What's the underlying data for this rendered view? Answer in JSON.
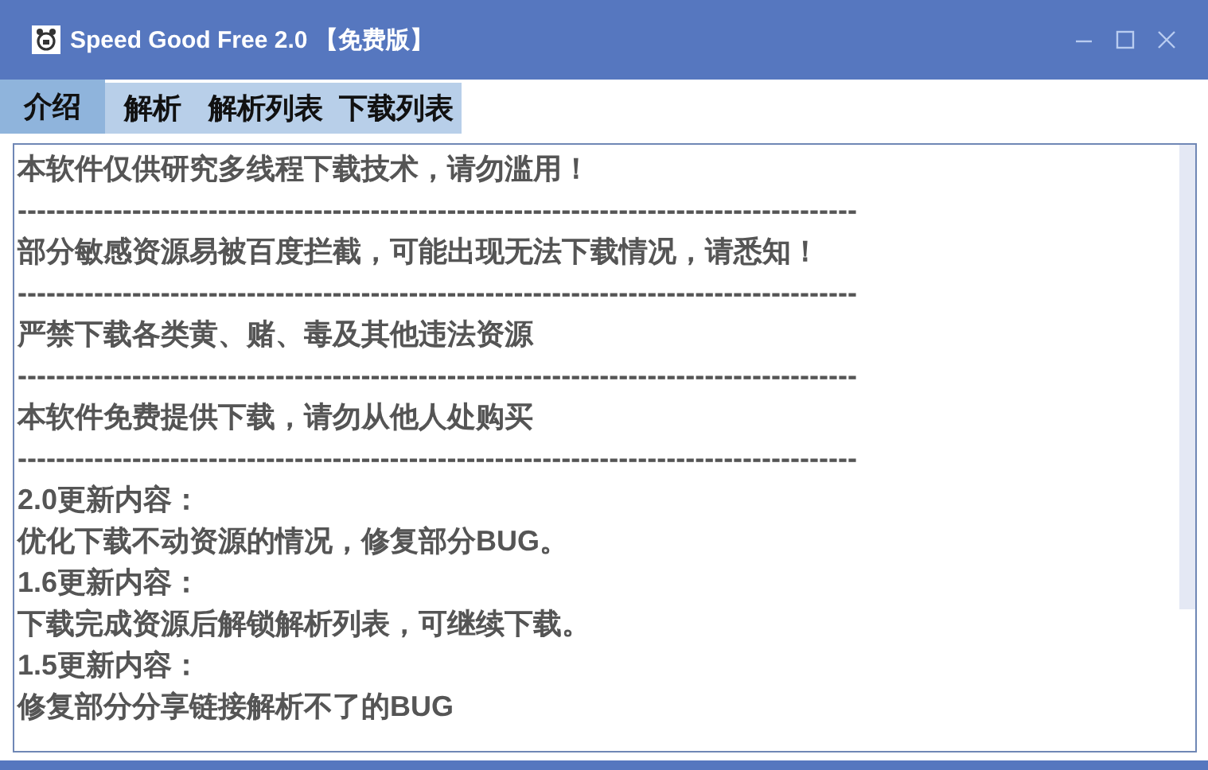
{
  "window": {
    "title": "Speed Good Free 2.0 【免费版】"
  },
  "tabs": [
    {
      "label": "介绍",
      "selected": true
    },
    {
      "label": "解析",
      "selected": false
    },
    {
      "label": "解析列表",
      "selected": false
    },
    {
      "label": "下载列表",
      "selected": false
    }
  ],
  "content": {
    "lines": [
      "本软件仅供研究多线程下载技术，请勿滥用！",
      "----------------------------------------------------------------------------------------",
      "部分敏感资源易被百度拦截，可能出现无法下载情况，请悉知！",
      "----------------------------------------------------------------------------------------",
      "严禁下载各类黄、赌、毒及其他违法资源",
      "----------------------------------------------------------------------------------------",
      "本软件免费提供下载，请勿从他人处购买",
      "----------------------------------------------------------------------------------------",
      "2.0更新内容：",
      "优化下载不动资源的情况，修复部分BUG。",
      "1.6更新内容：",
      "下载完成资源后解锁解析列表，可继续下载。",
      "1.5更新内容：",
      "修复部分分享链接解析不了的BUG"
    ]
  }
}
